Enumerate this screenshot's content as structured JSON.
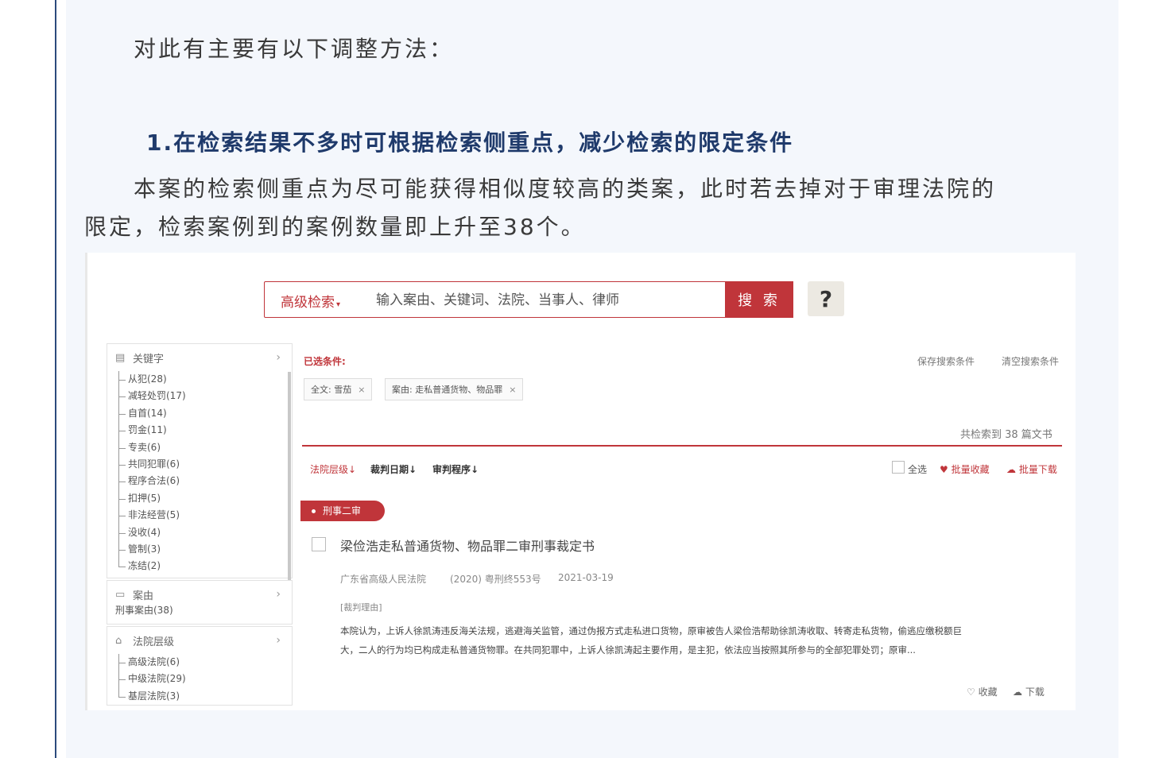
{
  "intro_text": "对此有主要有以下调整方法：",
  "heading": "1.在检索结果不多时可根据检索侧重点，减少检索的限定条件",
  "body_line1": "本案的检索侧重点为尽可能获得相似度较高的类案，此时若去掉对于审理法院的",
  "body_line2": "限定，检索案例到的案例数量即上升至38个。",
  "screenshot": {
    "search": {
      "advanced_label": "高级检索",
      "placeholder": "输入案由、关键词、法院、当事人、律师",
      "button_label": "搜 索",
      "help_label": "?"
    },
    "sidebar": {
      "keywords": {
        "title": "关键字",
        "items": [
          "从犯(28)",
          "减轻处罚(17)",
          "自首(14)",
          "罚金(11)",
          "专卖(6)",
          "共同犯罪(6)",
          "程序合法(6)",
          "扣押(5)",
          "非法经营(5)",
          "没收(4)",
          "管制(3)",
          "冻结(2)"
        ]
      },
      "cause": {
        "title": "案由",
        "items": [
          "刑事案由(38)"
        ]
      },
      "court_level": {
        "title": "法院层级",
        "items": [
          "高级法院(6)",
          "中级法院(29)",
          "基层法院(3)"
        ]
      }
    },
    "conditions": {
      "label": "已选条件:",
      "save": "保存搜索条件",
      "clear": "清空搜索条件",
      "tags": [
        "全文: 雪茄",
        "案由: 走私普通货物、物品罪"
      ]
    },
    "result_count": "共检索到 38 篇文书",
    "sort": [
      "法院层级",
      "裁判日期",
      "审判程序"
    ],
    "actions": {
      "select_all": "全选",
      "batch_collect": "批量收藏",
      "batch_download": "批量下载"
    },
    "result": {
      "badge": "刑事二审",
      "title": "梁俭浩走私普通货物、物品罪二审刑事裁定书",
      "court": "广东省高级人民法院",
      "case_no": "(2020) 粤刑终553号",
      "date": "2021-03-19",
      "reason_label": "[裁判理由]",
      "excerpt_line1": "本院认为，上诉人徐凯涛违反海关法规，逃避海关监管，通过伪报方式走私进口货物，原审被告人梁俭浩帮助徐凯涛收取、转寄走私货物，偷逃应缴税额巨",
      "excerpt_line2": "大，二人的行为均已构成走私普通货物罪。在共同犯罪中，上诉人徐凯涛起主要作用，是主犯，依法应当按照其所参与的全部犯罪处罚；原审...",
      "collect": "收藏",
      "download": "下载"
    }
  },
  "colors": {
    "frame_border": "#2c4a7c",
    "heading": "#1f3a6b",
    "accent_red": "#c0353a"
  }
}
